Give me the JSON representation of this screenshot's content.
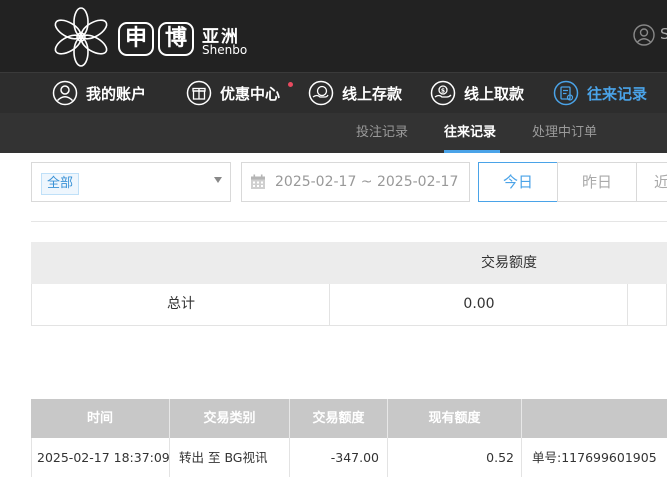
{
  "brand": {
    "logo_char_1": "申",
    "logo_char_2": "博",
    "name_cn": "亚洲",
    "name_en": "Shenbo"
  },
  "header": {
    "user_initial": "S"
  },
  "nav": {
    "items": [
      {
        "label": "我的账户",
        "icon": "user-circle-icon"
      },
      {
        "label": "优惠中心",
        "icon": "gift-icon",
        "has_dot": true
      },
      {
        "label": "线上存款",
        "icon": "deposit-icon"
      },
      {
        "label": "线上取款",
        "icon": "withdraw-icon"
      },
      {
        "label": "往来记录",
        "icon": "records-icon",
        "active": true
      }
    ]
  },
  "subnav": {
    "items": [
      {
        "label": "投注记录"
      },
      {
        "label": "往来记录",
        "active": true
      },
      {
        "label": "处理中订单"
      }
    ]
  },
  "filters": {
    "type_tag": "全部",
    "date_range": "2025-02-17 ~ 2025-02-17",
    "quick": [
      "今日",
      "昨日",
      "近"
    ]
  },
  "summary": {
    "header": "交易额度",
    "label": "总计",
    "value": "0.00"
  },
  "table": {
    "columns": [
      "时间",
      "交易类别",
      "交易额度",
      "现有额度",
      ""
    ],
    "rows": [
      [
        "2025-02-17 18:37:09",
        "转出 至 BG视讯",
        "-347.00",
        "0.52",
        "单号:117699601905"
      ]
    ]
  },
  "colors": {
    "accent": "#4aa3e8",
    "header_bg": "#222222",
    "nav_bg": "#2d2d2d",
    "subnav_bg": "#333333",
    "dot": "#e84a5f"
  }
}
